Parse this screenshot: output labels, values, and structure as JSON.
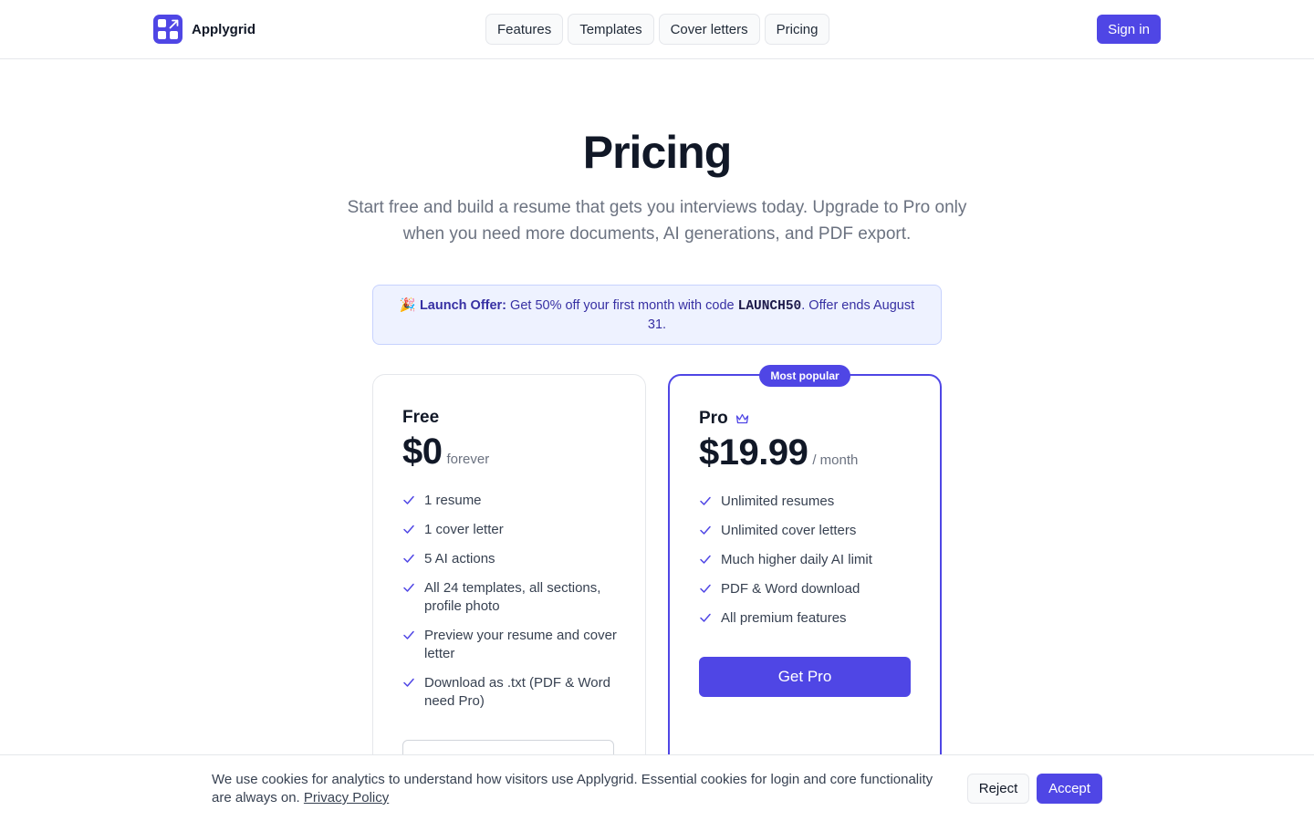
{
  "brand": {
    "name": "Applygrid",
    "accent_color": "#4f46e5"
  },
  "nav": {
    "items": [
      {
        "label": "Features"
      },
      {
        "label": "Templates"
      },
      {
        "label": "Cover letters"
      },
      {
        "label": "Pricing"
      }
    ],
    "signin_label": "Sign in"
  },
  "hero": {
    "title": "Pricing",
    "subtitle": "Start free and build a resume that gets you interviews today. Upgrade to Pro only when you need more documents, AI generations, and PDF export."
  },
  "offer": {
    "emoji": "🎉",
    "label": "Launch Offer:",
    "text_before_code": " Get 50% off your first month with code ",
    "code": "LAUNCH50",
    "text_after_code": ". Offer ends August 31."
  },
  "plans": {
    "free": {
      "name": "Free",
      "price": "$0",
      "period": "forever",
      "features": [
        "1 resume",
        "1 cover letter",
        "5 AI actions",
        "All 24 templates, all sections, profile photo",
        "Preview your resume and cover letter",
        "Download as .txt (PDF & Word need Pro)"
      ]
    },
    "pro": {
      "badge": "Most popular",
      "name": "Pro",
      "icon": "crown-icon",
      "price": "$19.99",
      "period": "/ month",
      "features": [
        "Unlimited resumes",
        "Unlimited cover letters",
        "Much higher daily AI limit",
        "PDF & Word download",
        "All premium features"
      ],
      "cta_label": "Get Pro"
    }
  },
  "cookie": {
    "text": "We use cookies for analytics to understand how visitors use Applygrid. Essential cookies for login and core functionality are always on. ",
    "link_label": "Privacy Policy",
    "reject_label": "Reject",
    "accept_label": "Accept"
  }
}
